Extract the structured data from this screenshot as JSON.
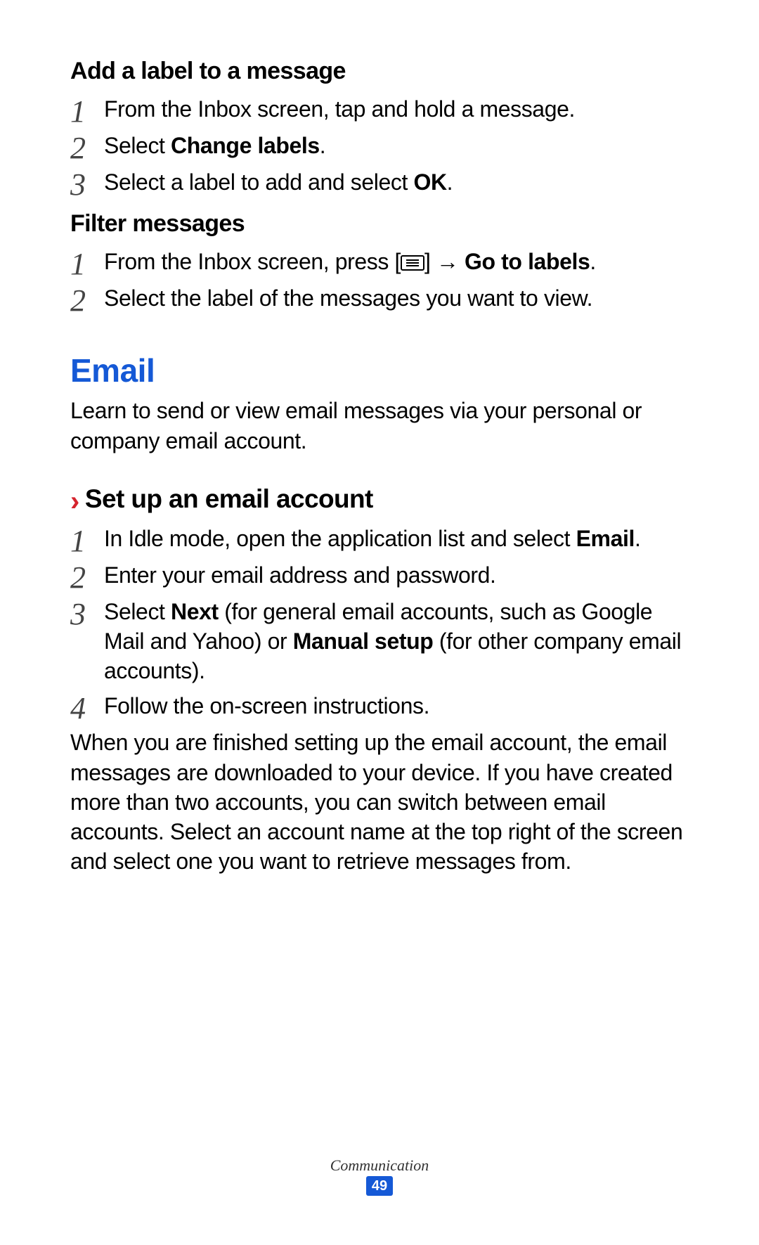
{
  "sections": {
    "addLabel": {
      "heading": "Add a label to a message",
      "steps": [
        {
          "text": "From the Inbox screen, tap and hold a message."
        },
        {
          "prefix": "Select ",
          "bold1": "Change labels",
          "suffix": "."
        },
        {
          "prefix": "Select a label to add and select ",
          "bold1": "OK",
          "suffix": "."
        }
      ]
    },
    "filter": {
      "heading": "Filter messages",
      "steps": [
        {
          "prefix": "From the Inbox screen, press [",
          "afterIcon": "] → ",
          "bold1": "Go to labels",
          "suffix": "."
        },
        {
          "text": "Select the label of the messages you want to view."
        }
      ]
    },
    "email": {
      "heading": "Email",
      "intro": "Learn to send or view email messages via your personal or company email account.",
      "setup": {
        "heading": "Set up an email account",
        "steps": [
          {
            "prefix": "In Idle mode, open the application list and select ",
            "bold1": "Email",
            "suffix": "."
          },
          {
            "text": "Enter your email address and password."
          },
          {
            "prefix": "Select ",
            "bold1": "Next",
            "mid": " (for general email accounts, such as Google Mail and Yahoo) or ",
            "bold2": "Manual setup",
            "suffix": " (for other company email accounts)."
          },
          {
            "text": "Follow the on-screen instructions."
          }
        ],
        "after": "When you are finished setting up the email account, the email messages are downloaded to your device. If you have created more than two accounts, you can switch between email accounts. Select an account name at the top right of the screen and select one you want to retrieve messages from."
      }
    }
  },
  "footer": {
    "section": "Communication",
    "page": "49"
  }
}
